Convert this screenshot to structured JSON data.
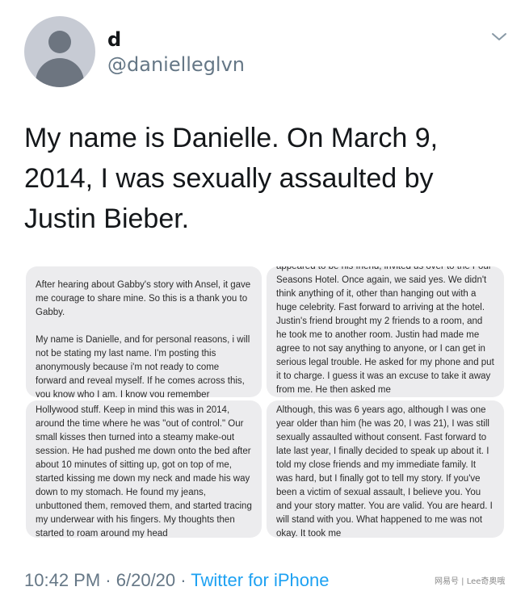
{
  "user": {
    "display_name": "d",
    "handle": "@danielleglvn"
  },
  "icons": {
    "more": "chevron-down-icon",
    "avatar": "default-profile-icon"
  },
  "colors": {
    "link": "#1da1f2",
    "secondary_text": "#657786",
    "avatar_bg": "#c7cbd4"
  },
  "tweet": {
    "text": "My name is Danielle. On March 9, 2014, I was sexually assaulted by Justin Bieber."
  },
  "attachment": {
    "panel1": {
      "para1": "After hearing about Gabby's story with Ansel, it gave me courage to share mine. So this is a thank you to Gabby.",
      "para2": "My name is Danielle, and for personal reasons, i will not be stating my last name. I'm posting this anonymously because i'm not ready to come forward and reveal myself. If he comes across this, you know who I am. I know you remember"
    },
    "panel2": {
      "text": "appeared to be his friend, invited us over to the Four Seasons Hotel. Once again, we said yes. We didn't think anything of it, other than hanging out with a huge celebrity. Fast forward to arriving at the hotel. Justin's friend brought my 2 friends to a room, and he took me to another room. Justin had made me agree to not say anything to anyone, or I can get in serious legal trouble. He asked for my phone and put it to charge. I guess it was an excuse to take it away from me. He then asked me"
    },
    "panel3": {
      "text": "Hollywood stuff.  Keep in mind this was in 2014, around the time where he was \"out of control.\" Our small kisses then turned into a steamy make-out session. He had pushed me down onto the bed after about 10 minutes of sitting up, got on top of me, started kissing me down my neck and made his way down to my stomach. He found my jeans, unbuttoned them, removed them, and started tracing my underwear with his fingers. My thoughts then started to roam around my head"
    },
    "panel4": {
      "text": "Although, this was 6 years ago, although I was one year older than him (he was 20, I was 21), I was still sexually assaulted without consent. Fast forward to late last year, I finally decided to speak up about it. I told my close friends and my immediate family. It was hard, but I finally got to tell my story. If you've been a victim of sexual assault, I believe you. You and your story matter. You are valid. You are heard. I will stand with you. What happened to me was not okay. It took me"
    }
  },
  "footer": {
    "time": "10:42 PM",
    "sep1": " · ",
    "date": "6/20/20",
    "sep2": " · ",
    "source": "Twitter for iPhone"
  },
  "watermark": "网易号 | Lee奇奥哦"
}
